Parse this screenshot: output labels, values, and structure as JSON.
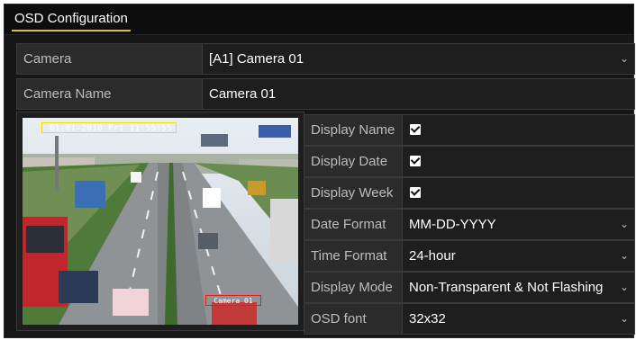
{
  "tab": {
    "label": "OSD Configuration"
  },
  "camera": {
    "label": "Camera",
    "value": "[A1] Camera 01"
  },
  "camera_name": {
    "label": "Camera Name",
    "value": "Camera 01"
  },
  "preview": {
    "osd_date_text": "01-01-2010 Fri 11:55:55",
    "osd_name_text": "Camera 01"
  },
  "settings": [
    {
      "label": "Display Name",
      "type": "checkbox",
      "checked": true
    },
    {
      "label": "Display Date",
      "type": "checkbox",
      "checked": true
    },
    {
      "label": "Display Week",
      "type": "checkbox",
      "checked": true
    },
    {
      "label": "Date Format",
      "type": "select",
      "value": "MM-DD-YYYY"
    },
    {
      "label": "Time Format",
      "type": "select",
      "value": "24-hour"
    },
    {
      "label": "Display Mode",
      "type": "select",
      "value": "Non-Transparent & Not Flashing"
    },
    {
      "label": "OSD font",
      "type": "select",
      "value": "32x32"
    }
  ],
  "icons": {
    "dropdown": "chevron-down-icon",
    "checkbox": "checkbox-checked-icon"
  },
  "colors": {
    "accent": "#e8c400",
    "osd_date_box": "#f0e000",
    "osd_name_box": "#e02020"
  }
}
